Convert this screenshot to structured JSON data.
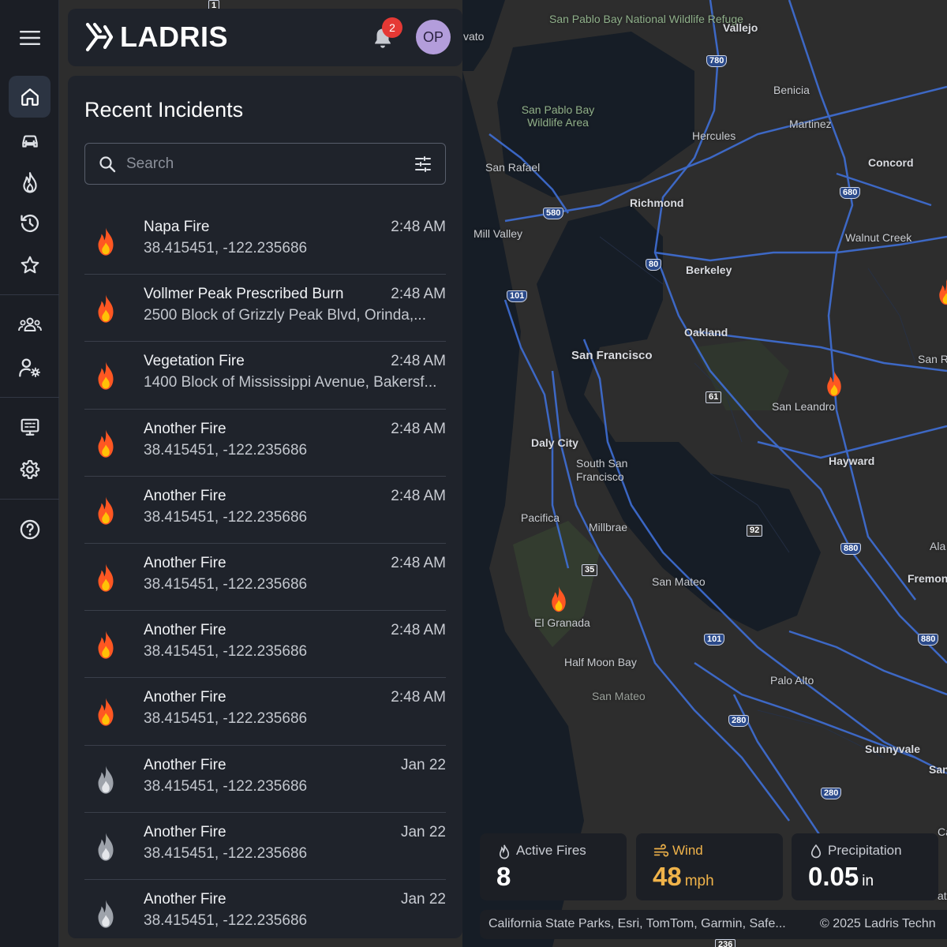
{
  "app": {
    "name": "LADRIS",
    "notification_count": "2",
    "avatar_initials": "OP"
  },
  "nav": {
    "items": [
      {
        "name": "home-icon"
      },
      {
        "name": "car-icon"
      },
      {
        "name": "fire-outline-icon"
      },
      {
        "name": "history-icon"
      },
      {
        "name": "star-icon"
      },
      {
        "name": "group-icon"
      },
      {
        "name": "user-settings-icon"
      },
      {
        "name": "monitor-icon"
      },
      {
        "name": "gear-icon"
      },
      {
        "name": "help-icon"
      }
    ]
  },
  "panel": {
    "title": "Recent Incidents",
    "search_placeholder": "Search"
  },
  "incidents": [
    {
      "title": "Napa Fire",
      "time": "2:48 AM",
      "subtitle": "38.415451, -122.235686",
      "status": "active"
    },
    {
      "title": "Vollmer Peak Prescribed Burn",
      "time": "2:48 AM",
      "subtitle": "2500 Block of Grizzly Peak Blvd, Orinda,...",
      "status": "active"
    },
    {
      "title": "Vegetation Fire",
      "time": "2:48 AM",
      "subtitle": "1400 Block of Mississippi Avenue, Bakersf...",
      "status": "active"
    },
    {
      "title": "Another Fire",
      "time": "2:48 AM",
      "subtitle": "38.415451, -122.235686",
      "status": "active"
    },
    {
      "title": "Another Fire",
      "time": "2:48 AM",
      "subtitle": "38.415451, -122.235686",
      "status": "active"
    },
    {
      "title": "Another Fire",
      "time": "2:48 AM",
      "subtitle": "38.415451, -122.235686",
      "status": "active"
    },
    {
      "title": "Another Fire",
      "time": "2:48 AM",
      "subtitle": "38.415451, -122.235686",
      "status": "active"
    },
    {
      "title": "Another Fire",
      "time": "2:48 AM",
      "subtitle": "38.415451, -122.235686",
      "status": "active"
    },
    {
      "title": "Another Fire",
      "time": "Jan 22",
      "subtitle": "38.415451, -122.235686",
      "status": "inactive"
    },
    {
      "title": "Another Fire",
      "time": "Jan 22",
      "subtitle": "38.415451, -122.235686",
      "status": "inactive"
    },
    {
      "title": "Another Fire",
      "time": "Jan 22",
      "subtitle": "38.415451, -122.235686",
      "status": "inactive"
    }
  ],
  "stats": {
    "active_fires": {
      "label": "Active Fires",
      "value": "8"
    },
    "wind": {
      "label": "Wind",
      "value": "48",
      "unit": "mph"
    },
    "precipitation": {
      "label": "Precipitation",
      "value": "0.05",
      "unit": "in"
    }
  },
  "map": {
    "attribution": "California State Parks, Esri, TomTom, Garmin, Safe...",
    "copyright": "© 2025 Ladris Techn",
    "labels": [
      "San Pablo Bay National Wildlife Refuge",
      "Vallejo",
      "vato",
      "Benicia",
      "San Pablo Bay Wildlife Area",
      "Martinez",
      "Hercules",
      "Concord",
      "San Rafael",
      "Richmond",
      "Walnut Creek",
      "Mill Valley",
      "Berkeley",
      "Oakland",
      "San Francisco",
      "San R",
      "San Leandro",
      "Daly City",
      "South San Francisco",
      "Hayward",
      "Pacifica",
      "Millbrae",
      "Ala",
      "San Mateo",
      "Fremon",
      "El Granada",
      "Half Moon Bay",
      "Palo Alto",
      "San Mateo",
      "Sunnyvale",
      "San",
      "Ca",
      "at"
    ],
    "shields": [
      "780",
      "680",
      "580",
      "80",
      "101",
      "61",
      "92",
      "880",
      "35",
      "101",
      "880",
      "280",
      "280",
      "236",
      "1"
    ]
  },
  "colors": {
    "fire_active": "#ff5722",
    "fire_inactive": "#9ea3ab",
    "wind_accent": "#f0b34a",
    "road": "#3f6fd6",
    "water": "#161d26",
    "land": "#2d2d2d"
  }
}
